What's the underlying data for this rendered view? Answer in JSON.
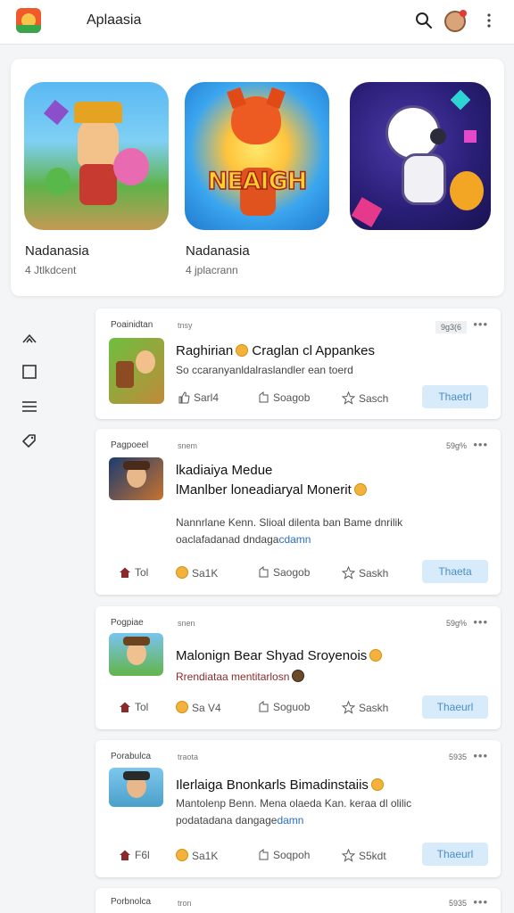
{
  "header": {
    "title": "Aplaasia",
    "icons": [
      "app-logo",
      "search-icon",
      "avatar",
      "more-vertical-icon"
    ]
  },
  "featured": [
    {
      "name": "Nadanasia",
      "sub": "4 Jtlkdcent"
    },
    {
      "name": "Nadanasia",
      "sub": "4 jplacrann",
      "art_text": "NEAIGH"
    },
    {
      "name": "",
      "sub": ""
    }
  ],
  "rail": [
    "cursor-icon",
    "square-icon",
    "menu-icon",
    "tag-icon"
  ],
  "posts": [
    {
      "category": "Poainidtan",
      "type": "tnsy",
      "count": "9g3(6",
      "more": "•••",
      "title_lines": [
        "Raghirian",
        "Craglan cl Appankes"
      ],
      "sub": "So ccaranyanldalraslandler  ean toerd",
      "actions": {
        "a": "Sarl4",
        "b": "Soagob",
        "c": "Sasch"
      },
      "cta": "Thaetrl"
    },
    {
      "category": "Pagpoeel",
      "type": "snem",
      "count": "59g%",
      "more": "•••",
      "title_lines": [
        "lkadiaiya Medue",
        "lManlber  loneadiaryal Monerit"
      ],
      "sub_a": "Nannrlane Kenn. Slioal dilenta  ban Bame dnrilik",
      "sub_b": "oaclafadanad dndaga",
      "sub_link": "cdamn",
      "actions": {
        "home": "Tol",
        "a": "Sa1K",
        "b": "Saogob",
        "c": "Saskh"
      },
      "cta": "Thaeta"
    },
    {
      "category": "Pogpiae",
      "type": "snen",
      "count": "59g%",
      "more": "•••",
      "title_lines": [
        "Malonign  Bear  Shyad  Sroyenois"
      ],
      "sub": "Rrendiataa mentitarlosn",
      "actions": {
        "home": "Tol",
        "a": "Sa V4",
        "b": "Soguob",
        "c": "Saskh"
      },
      "cta": "Thaeurl"
    },
    {
      "category": "Porabulca",
      "type": "traota",
      "count": "5935",
      "more": "•••",
      "title_lines": [
        "Ilerlaiga  Bnonkarls  Bimadinstaiis"
      ],
      "sub_a": "Mantolenp Benn. Mena olaeda  Kan. keraa dl olilic",
      "sub_b": "podatadana dangage",
      "sub_link": "damn",
      "actions": {
        "home": "F6l",
        "a": "Sa1K",
        "b": "Soqpoh",
        "c": "S5kdt"
      },
      "cta": "Thaeurl"
    },
    {
      "category": "Porbnolca",
      "type": "tron",
      "count": "5935",
      "more": "•••"
    }
  ]
}
